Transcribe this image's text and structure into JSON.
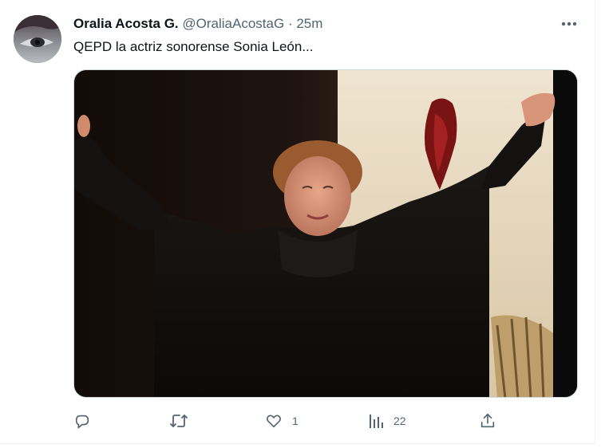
{
  "tweet": {
    "author_name": "Oralia Acosta G.",
    "handle": "@OraliaAcostaG",
    "separator": "·",
    "time": "25m",
    "text": "QEPD la actriz sonorense Sonia León...",
    "actions": {
      "reply_count": "",
      "retweet_count": "",
      "like_count": "1",
      "views_count": "22"
    }
  },
  "colors": {
    "text_primary": "#0f1419",
    "text_secondary": "#536471",
    "border": "#cfd9de"
  },
  "icons": [
    "more-icon",
    "reply-icon",
    "retweet-icon",
    "like-icon",
    "views-icon",
    "share-icon"
  ]
}
